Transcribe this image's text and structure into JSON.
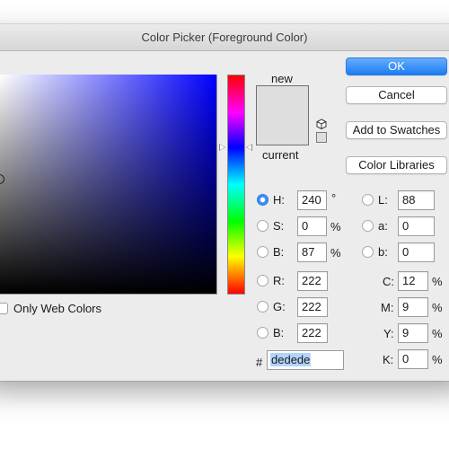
{
  "window": {
    "title": "Color Picker (Foreground Color)"
  },
  "colors": {
    "current": "#dedede",
    "new": "#dedede",
    "accent": "#1b7cf5"
  },
  "swatch": {
    "new_label": "new",
    "current_label": "current",
    "websafe_icon": "cube-icon"
  },
  "buttons": {
    "ok": "OK",
    "cancel": "Cancel",
    "add_to_swatches": "Add to Swatches",
    "color_libraries": "Color Libraries"
  },
  "only_web_colors": {
    "label": "Only Web Colors",
    "checked": false
  },
  "hsb": {
    "h": {
      "label": "H:",
      "value": "240",
      "unit": "°",
      "selected": true
    },
    "s": {
      "label": "S:",
      "value": "0",
      "unit": "%"
    },
    "b": {
      "label": "B:",
      "value": "87",
      "unit": "%"
    }
  },
  "rgb": {
    "r": {
      "label": "R:",
      "value": "222"
    },
    "g": {
      "label": "G:",
      "value": "222"
    },
    "b": {
      "label": "B:",
      "value": "222"
    }
  },
  "lab": {
    "l": {
      "label": "L:",
      "value": "88"
    },
    "a": {
      "label": "a:",
      "value": "0"
    },
    "b": {
      "label": "b:",
      "value": "0"
    }
  },
  "cmyk": {
    "c": {
      "label": "C:",
      "value": "12",
      "unit": "%"
    },
    "m": {
      "label": "M:",
      "value": "9",
      "unit": "%"
    },
    "y": {
      "label": "Y:",
      "value": "9",
      "unit": "%"
    },
    "k": {
      "label": "K:",
      "value": "0",
      "unit": "%"
    }
  },
  "hex": {
    "label": "#",
    "value": "dedede"
  }
}
